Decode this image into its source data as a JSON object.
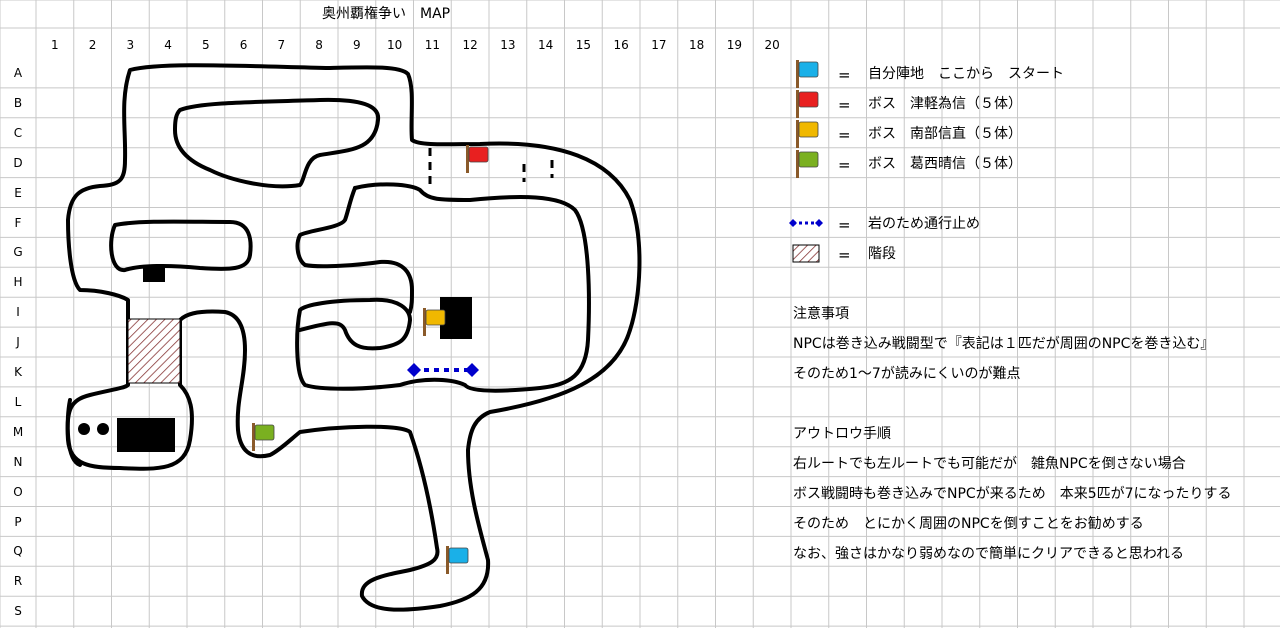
{
  "title": "奥州覇権争い　MAP",
  "columns": [
    "1",
    "2",
    "3",
    "4",
    "5",
    "6",
    "7",
    "8",
    "9",
    "10",
    "11",
    "12",
    "13",
    "14",
    "15",
    "16",
    "17",
    "18",
    "19",
    "20"
  ],
  "rows": [
    "A",
    "B",
    "C",
    "D",
    "E",
    "F",
    "G",
    "H",
    "I",
    "J",
    "K",
    "L",
    "M",
    "N",
    "O",
    "P",
    "Q",
    "R",
    "S"
  ],
  "legend": {
    "equals": "=",
    "items": [
      {
        "icon": "flag-cyan-icon",
        "color": "#1ab0e8",
        "label": "自分陣地　ここから　スタート"
      },
      {
        "icon": "flag-red-icon",
        "color": "#e82020",
        "label": "ボス　津軽為信（５体）"
      },
      {
        "icon": "flag-yellow-icon",
        "color": "#f0b800",
        "label": "ボス　南部信直（５体）"
      },
      {
        "icon": "flag-green-icon",
        "color": "#7ab020",
        "label": "ボス　葛西晴信（５体）"
      },
      {
        "icon": "dotted-line-icon",
        "color": "#0000cc",
        "label": "岩のため通行止め"
      },
      {
        "icon": "hatch-icon",
        "color": "#a05050",
        "label": "階段"
      }
    ]
  },
  "notes": [
    "注意事項",
    "NPCは巻き込み戦闘型で『表記は１匹だが周囲のNPCを巻き込む』",
    "そのため1～7が読みにくいのが難点",
    "アウトロウ手順",
    "右ルートでも左ルートでも可能だが　雑魚NPCを倒さない場合",
    "ボス戦闘時も巻き込みでNPCが来るため　本来5匹が7になったりする",
    "そのため　とにかく周囲のNPCを倒すことをお勧めする",
    "なお、強さはかなり弱めなので簡単にクリアできると思われる"
  ]
}
